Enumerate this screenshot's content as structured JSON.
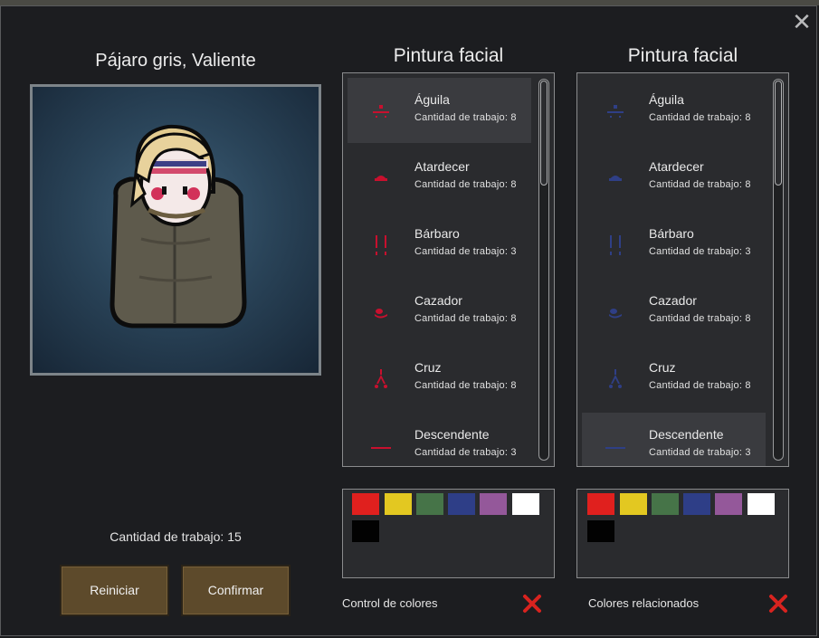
{
  "pawn": {
    "title": "Pájaro gris, Valiente",
    "work_total": "Cantidad de trabajo: 15"
  },
  "buttons": {
    "reset": "Reiniciar",
    "confirm": "Confirmar"
  },
  "columns": [
    {
      "title": "Pintura facial",
      "accent": "#c8102e",
      "selected_index": 0,
      "items": [
        {
          "name": "Águila",
          "work": "Cantidad de trabajo: 8",
          "icon": "eagle-icon"
        },
        {
          "name": "Atardecer",
          "work": "Cantidad de trabajo: 8",
          "icon": "sunset-icon"
        },
        {
          "name": "Bárbaro",
          "work": "Cantidad de trabajo: 3",
          "icon": "barbarian-icon"
        },
        {
          "name": "Cazador",
          "work": "Cantidad de trabajo: 8",
          "icon": "hunter-icon"
        },
        {
          "name": "Cruz",
          "work": "Cantidad de trabajo: 8",
          "icon": "cross-icon"
        },
        {
          "name": "Descendente",
          "work": "Cantidad de trabajo: 3",
          "icon": "descending-icon"
        }
      ],
      "colors": [
        "#e0201e",
        "#e3c821",
        "#467448",
        "#2e3e87",
        "#94589a",
        "#ffffff",
        "#020202"
      ],
      "option_label": "Control de colores"
    },
    {
      "title": "Pintura facial",
      "accent": "#2f3f86",
      "selected_index": 5,
      "items": [
        {
          "name": "Águila",
          "work": "Cantidad de trabajo: 8",
          "icon": "eagle-icon"
        },
        {
          "name": "Atardecer",
          "work": "Cantidad de trabajo: 8",
          "icon": "sunset-icon"
        },
        {
          "name": "Bárbaro",
          "work": "Cantidad de trabajo: 3",
          "icon": "barbarian-icon"
        },
        {
          "name": "Cazador",
          "work": "Cantidad de trabajo: 8",
          "icon": "hunter-icon"
        },
        {
          "name": "Cruz",
          "work": "Cantidad de trabajo: 8",
          "icon": "cross-icon"
        },
        {
          "name": "Descendente",
          "work": "Cantidad de trabajo: 3",
          "icon": "descending-icon"
        }
      ],
      "colors": [
        "#e0201e",
        "#e3c821",
        "#467448",
        "#2e3e87",
        "#94589a",
        "#ffffff",
        "#020202"
      ],
      "option_label": "Colores relacionados"
    }
  ]
}
